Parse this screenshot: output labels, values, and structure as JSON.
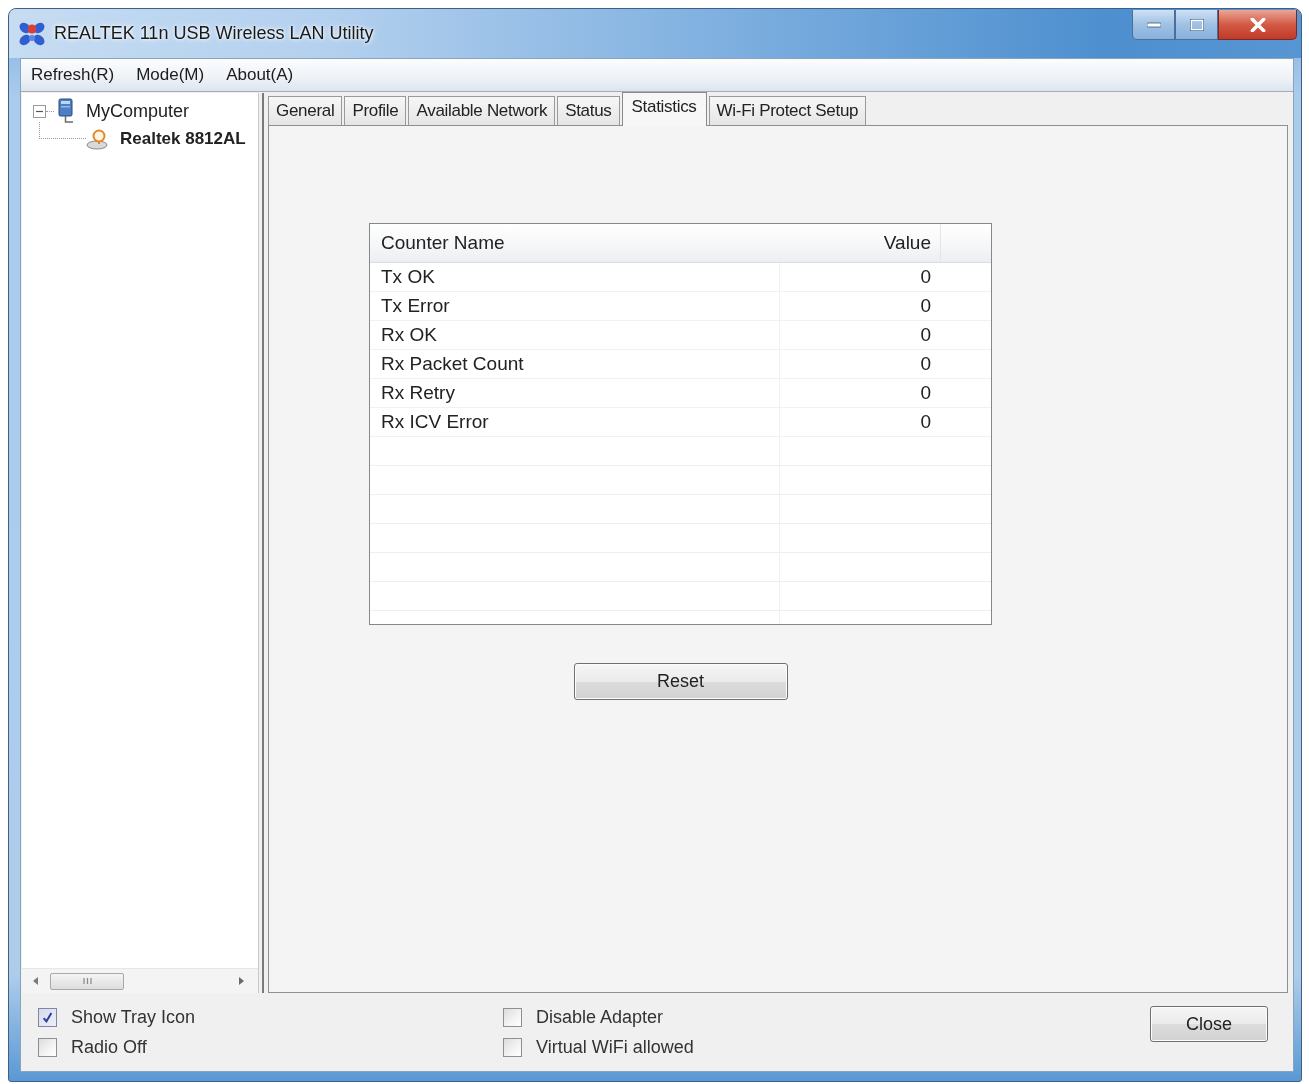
{
  "window": {
    "title": "REALTEK 11n USB Wireless LAN Utility"
  },
  "menu": [
    "Refresh(R)",
    "Mode(M)",
    "About(A)"
  ],
  "tree": [
    {
      "label": "MyComputer",
      "expanded": true,
      "children": [
        {
          "label": "Realtek 8812AL"
        }
      ]
    }
  ],
  "tabs": [
    {
      "label": "General",
      "selected": false
    },
    {
      "label": "Profile",
      "selected": false
    },
    {
      "label": "Available Network",
      "selected": false
    },
    {
      "label": "Status",
      "selected": false
    },
    {
      "label": "Statistics",
      "selected": true
    },
    {
      "label": "Wi-Fi Protect Setup",
      "selected": false
    }
  ],
  "statistics": {
    "columns": [
      "Counter Name",
      "Value"
    ],
    "rows": [
      {
        "counter": "Tx OK",
        "value": "0"
      },
      {
        "counter": "Tx Error",
        "value": "0"
      },
      {
        "counter": "Rx OK",
        "value": "0"
      },
      {
        "counter": "Rx Packet Count",
        "value": "0"
      },
      {
        "counter": "Rx Retry",
        "value": "0"
      },
      {
        "counter": "Rx ICV Error",
        "value": "0"
      }
    ],
    "reset_button": "Reset"
  },
  "options": [
    {
      "items": [
        {
          "label": "Show Tray Icon",
          "checked": true
        },
        {
          "label": "Radio Off",
          "checked": false
        }
      ]
    },
    {
      "items": [
        {
          "label": "Disable Adapter",
          "checked": false
        },
        {
          "label": "Virtual WiFi allowed",
          "checked": false
        }
      ]
    }
  ],
  "close_button": "Close"
}
